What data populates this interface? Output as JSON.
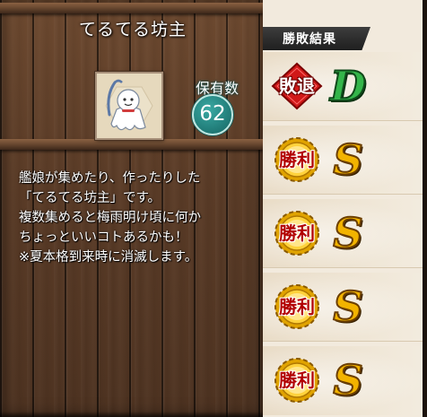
{
  "item": {
    "name": "てるてる坊主",
    "icon": "teru-teru-bozu-doll-icon",
    "owned_label": "保有数",
    "owned_count": "62",
    "description_lines": [
      "艦娘が集めたり、作ったりした",
      "「てるてる坊主」です。",
      "複数集めると梅雨明け頃に何か",
      "ちょっといいコトあるかも！",
      "※夏本格到来時に消滅します。"
    ]
  },
  "results": {
    "header": "勝敗結果",
    "entries": [
      {
        "result": "敗退",
        "rank": "D",
        "badge_icon": "defeat-red-diamond-icon"
      },
      {
        "result": "勝利",
        "rank": "S",
        "badge_icon": "victory-gold-gear-icon"
      },
      {
        "result": "勝利",
        "rank": "S",
        "badge_icon": "victory-gold-gear-icon"
      },
      {
        "result": "勝利",
        "rank": "S",
        "badge_icon": "victory-gold-gear-icon"
      },
      {
        "result": "勝利",
        "rank": "S",
        "badge_icon": "victory-gold-gear-icon"
      }
    ]
  },
  "colors": {
    "wood": "#5b3c27",
    "teal_badge": "#23807c",
    "rank_s": "#f2b300",
    "rank_d": "#34b54a",
    "defeat_red": "#d01818"
  }
}
